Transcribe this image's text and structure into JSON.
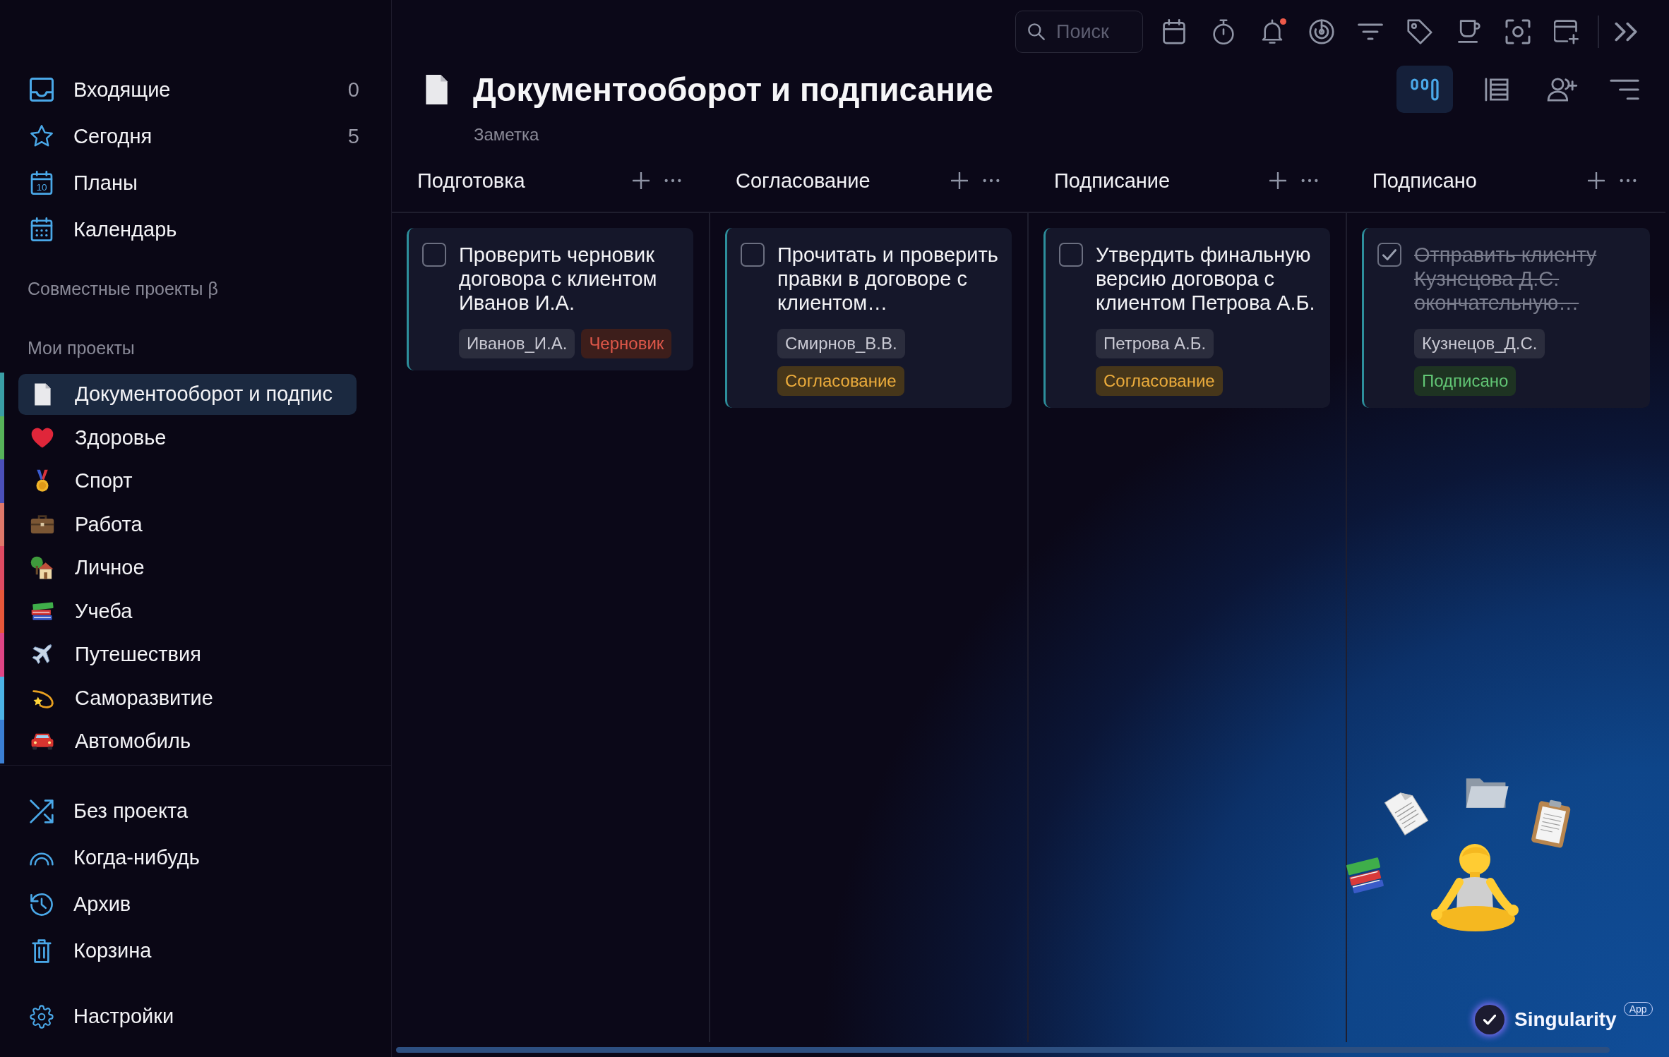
{
  "toolbar": {
    "search": {
      "placeholder": "Поиск"
    },
    "notifications": {
      "unread": true
    }
  },
  "sidebar": {
    "nav_items": [
      {
        "label": "Входящие",
        "count": "0",
        "selected": false
      },
      {
        "label": "Сегодня",
        "count": "5",
        "selected": false
      },
      {
        "label": "Планы",
        "icon_text": "10",
        "selected": false
      },
      {
        "label": "Календарь",
        "selected": false
      }
    ],
    "shared_projects_heading": "Совместные проекты β",
    "my_projects_heading": "Мои проекты",
    "projects": [
      {
        "label": "Документооборот и подпис",
        "color": "#3a9ea5",
        "selected": true
      },
      {
        "label": "Здоровье",
        "color": "#57b35a",
        "selected": false
      },
      {
        "label": "Спорт",
        "color": "#4b4fb8",
        "selected": false
      },
      {
        "label": "Работа",
        "color": "#e0786a",
        "selected": false
      },
      {
        "label": "Личное",
        "color": "#e04a62",
        "selected": false
      },
      {
        "label": "Учеба",
        "color": "#e8573a",
        "selected": false
      },
      {
        "label": "Путешествия",
        "color": "#e04585",
        "selected": false
      },
      {
        "label": "Саморазвитие",
        "color": "#4db3e6",
        "selected": false
      },
      {
        "label": "Автомобиль",
        "color": "#3b7fd4",
        "selected": false
      }
    ],
    "bottom_items": [
      {
        "label": "Без проекта",
        "selected": false
      },
      {
        "label": "Когда-нибудь",
        "selected": false
      },
      {
        "label": "Архив",
        "selected": false
      },
      {
        "label": "Корзина",
        "selected": false
      }
    ],
    "settings": {
      "label": "Настройки"
    }
  },
  "header": {
    "title": "Документооборот и подписание",
    "subtitle": "Заметка",
    "views": [
      {
        "kind": "board",
        "selected": true
      },
      {
        "kind": "list",
        "selected": false
      }
    ]
  },
  "board": {
    "columns": [
      {
        "title": "Подготовка",
        "cards": [
          {
            "text": "Проверить черновик договора с клиентом Иванов И.А.",
            "checked": false,
            "tags": [
              {
                "label": "Иванов_И.А.",
                "kind": "person"
              },
              {
                "label": "Черновик",
                "kind": "status",
                "color": "#3d1e1b"
              }
            ]
          }
        ]
      },
      {
        "title": "Согласование",
        "cards": [
          {
            "text": "Прочитать и проверить правки в договоре с клиентом…",
            "checked": false,
            "tags": [
              {
                "label": "Смирнов_В.В.",
                "kind": "person"
              },
              {
                "label": "Согласование",
                "kind": "status",
                "color": "#46361a"
              }
            ]
          }
        ]
      },
      {
        "title": "Подписание",
        "cards": [
          {
            "text": "Утвердить финальную версию договора с клиентом Петрова А.Б.",
            "checked": false,
            "tags": [
              {
                "label": "Петрова А.Б.",
                "kind": "person"
              },
              {
                "label": "Согласование",
                "kind": "status",
                "color": "#46361a"
              }
            ]
          }
        ]
      },
      {
        "title": "Подписано",
        "cards": [
          {
            "text": "Отправить клиенту Кузнецова Д.С. окончательную…",
            "checked": true,
            "tags": [
              {
                "label": "Кузнецов_Д.С.",
                "kind": "person"
              },
              {
                "label": "Подписано",
                "kind": "status",
                "color": "#1e3322"
              }
            ]
          }
        ]
      }
    ]
  },
  "branding": {
    "name": "Singularity",
    "badge": "App"
  }
}
